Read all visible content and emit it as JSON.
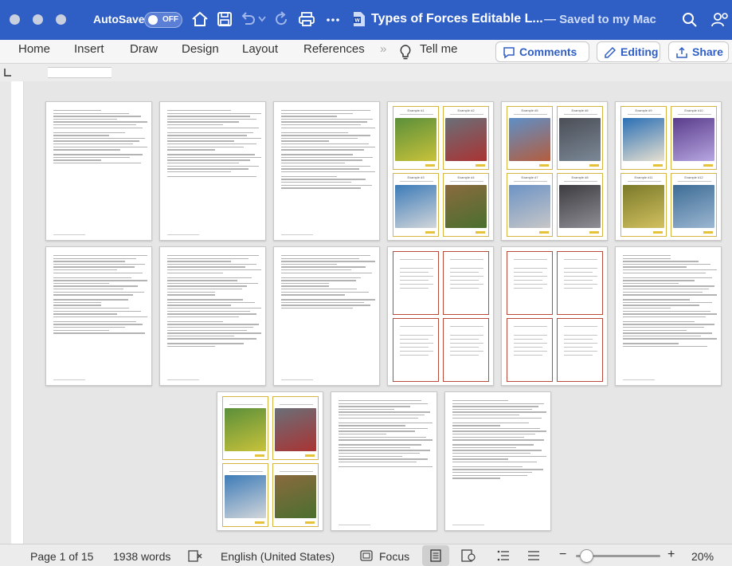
{
  "window": {
    "autosave_label": "AutoSave",
    "autosave_state": "OFF",
    "doc_title": "Types of Forces Editable L...",
    "doc_status": "— Saved to my Mac"
  },
  "ribbon": {
    "tabs": [
      "Home",
      "Insert",
      "Draw",
      "Design",
      "Layout",
      "References"
    ],
    "overflow": "»",
    "tell_me": "Tell me",
    "comments_label": "Comments",
    "editing_label": "Editing",
    "share_label": "Share"
  },
  "thumbnails": {
    "card_titles": {
      "p4": [
        "Example #1",
        "Example #2",
        "Example #3",
        "Example #4"
      ],
      "p5": [
        "Example #5",
        "Example #6",
        "Example #7",
        "Example #8"
      ],
      "p6": [
        "Example #9",
        "Example #10",
        "Example #11",
        "Example #12"
      ]
    }
  },
  "status": {
    "page": "Page 1 of 15",
    "words": "1938 words",
    "language": "English (United States)",
    "focus": "Focus",
    "zoom_minus": "−",
    "zoom_plus": "+",
    "zoom": "20%"
  },
  "colors": {
    "titlebar": "#2f5ec4",
    "accent": "#2f5ec4",
    "card_yellow": "#d6b640",
    "card_red": "#b94a3a"
  },
  "zoom_level_percent": 20
}
